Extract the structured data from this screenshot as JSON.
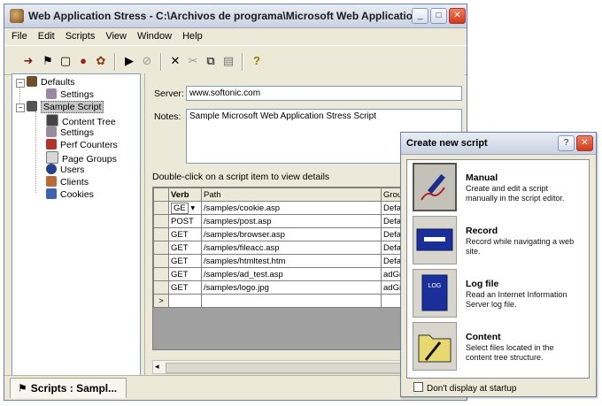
{
  "window": {
    "title": "Web Application Stress - C:\\Archivos de programa\\Microsoft Web Applicatio...",
    "minimize_glyph": "_",
    "maximize_glyph": "□",
    "close_glyph": "✕"
  },
  "menu": [
    "File",
    "Edit",
    "Scripts",
    "View",
    "Window",
    "Help"
  ],
  "toolbar": {
    "icons": [
      "run-icon",
      "flag-icon",
      "new-icon",
      "record-icon",
      "settings-icon",
      "play-icon",
      "stop-icon",
      "delete-icon",
      "cut-icon",
      "copy-icon",
      "paste-icon",
      "help-icon"
    ],
    "glyphs": [
      "➜",
      "⚑",
      "▢",
      "●",
      "✿",
      "▶",
      "⊘",
      "✕",
      "✂",
      "⧉",
      "▤",
      "?"
    ]
  },
  "tree": {
    "defaults": "Defaults",
    "defaults_settings": "Settings",
    "script": "Sample Script",
    "children": [
      "Content Tree",
      "Settings",
      "Perf Counters",
      "Page Groups",
      "Users",
      "Clients",
      "Cookies"
    ]
  },
  "details": {
    "server_label": "Server:",
    "server_value": "www.softonic.com",
    "notes_label": "Notes:",
    "notes_value": "Sample Microsoft Web Application Stress Script",
    "hint": "Double-click on a script item to view details"
  },
  "grid": {
    "columns": [
      "Verb",
      "Path",
      "Grou"
    ],
    "rows": [
      {
        "verb": "GE",
        "path": "/samples/cookie.asp",
        "group": "Defa"
      },
      {
        "verb": "POST",
        "path": "/samples/post.asp",
        "group": "Defa"
      },
      {
        "verb": "GET",
        "path": "/samples/browser.asp",
        "group": "Defa"
      },
      {
        "verb": "GET",
        "path": "/samples/fileacc.asp",
        "group": "Defa"
      },
      {
        "verb": "GET",
        "path": "/samples/htmltest.htm",
        "group": "Defa"
      },
      {
        "verb": "GET",
        "path": "/samples/ad_test.asp",
        "group": "adGr"
      },
      {
        "verb": "GET",
        "path": "/samples/logo.jpg",
        "group": "adGr"
      }
    ],
    "new_row_marker": ">"
  },
  "status_tab": "Scripts : Sampl...",
  "dialog": {
    "title": "Create new script",
    "help_glyph": "?",
    "close_glyph": "✕",
    "options": [
      {
        "name": "Manual",
        "desc": "Create and edit a script manually in the script editor.",
        "icon": "pen-icon"
      },
      {
        "name": "Record",
        "desc": "Record while navigating a web site.",
        "icon": "tape-icon"
      },
      {
        "name": "Log file",
        "desc": "Read an Internet Information Server log file.",
        "icon": "log-icon",
        "icon_label": "LOG"
      },
      {
        "name": "Content",
        "desc": "Select files located in the content tree structure.",
        "icon": "folder-icon"
      }
    ],
    "checkbox_label": "Don't display at startup"
  }
}
